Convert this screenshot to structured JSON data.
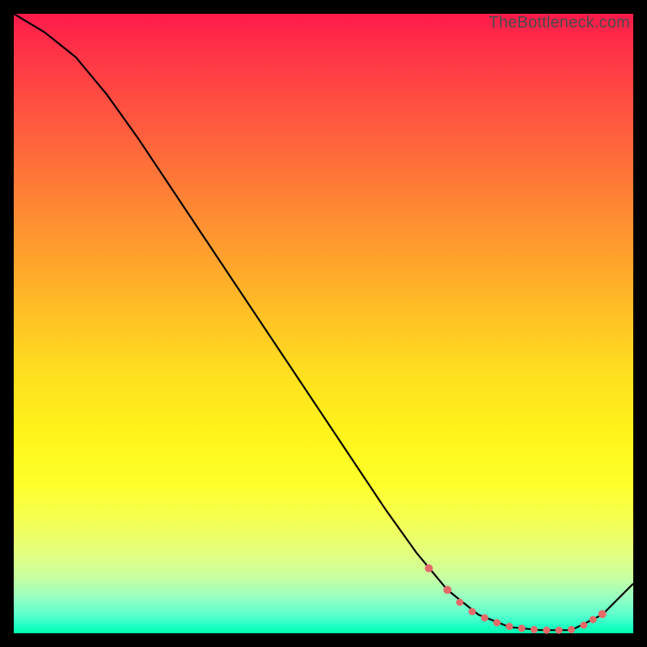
{
  "watermark": "TheBottleneck.com",
  "colors": {
    "background": "#000000",
    "curve": "#000000",
    "marker_fill": "#e46a6a",
    "marker_stroke": "#d85a5a"
  },
  "chart_data": {
    "type": "line",
    "title": "",
    "xlabel": "",
    "ylabel": "",
    "xlim": [
      0,
      100
    ],
    "ylim": [
      0,
      100
    ],
    "series": [
      {
        "name": "curve",
        "x": [
          0,
          5,
          10,
          15,
          20,
          25,
          30,
          35,
          40,
          45,
          50,
          55,
          60,
          65,
          70,
          75,
          80,
          85,
          90,
          95,
          100
        ],
        "y": [
          100,
          97,
          93,
          87,
          80,
          72.5,
          65,
          57.5,
          50,
          42.5,
          35,
          27.5,
          20,
          13,
          7,
          3,
          1,
          0.5,
          0.5,
          3,
          8
        ]
      }
    ],
    "markers": {
      "name": "highlight-dots",
      "x": [
        67,
        70,
        72,
        74,
        76,
        78,
        80,
        82,
        84,
        86,
        88,
        90,
        92,
        93.5,
        95
      ],
      "y": [
        10.5,
        7,
        5,
        3.5,
        2.5,
        1.7,
        1.1,
        0.8,
        0.6,
        0.5,
        0.5,
        0.6,
        1.3,
        2.2,
        3.1
      ],
      "r": [
        5,
        5,
        4.5,
        4.5,
        4.5,
        4.5,
        4.5,
        4.5,
        4.5,
        4.5,
        4.5,
        4.5,
        4.5,
        4.5,
        5
      ]
    }
  }
}
